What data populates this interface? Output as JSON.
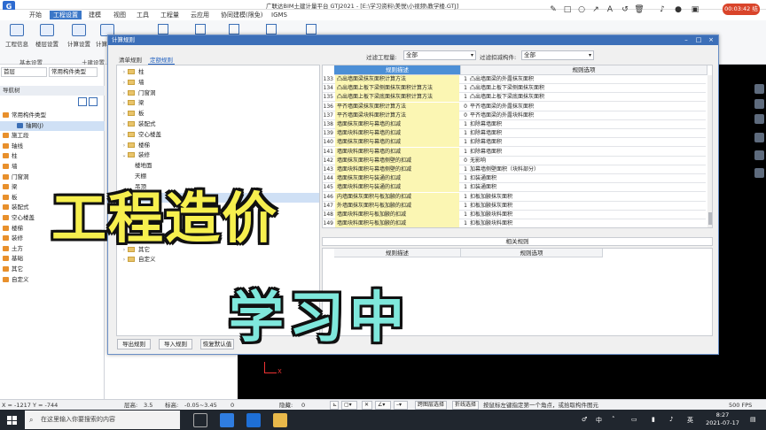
{
  "app": {
    "title": "广联达BIM土建计量平台 GTJ2021 - [E:\\学习资料\\美悦\\小视频\\教学楼.GTJ]",
    "timer": "00:03:42 结束"
  },
  "menu": [
    "开始",
    "工程设置",
    "建模",
    "视图",
    "工具",
    "工程量",
    "云应用",
    "协同建模(限免)",
    "IGMS"
  ],
  "menu_active": "工程设置",
  "ribbon": {
    "buttons": [
      "工程信息",
      "楼层设置",
      "计算设置",
      "计算规则"
    ],
    "groups": [
      "基本设置",
      "土建设置"
    ]
  },
  "left_panel": {
    "floor_combo": "首层",
    "type_combo": "常用构件类型",
    "axis_combo": "轴网",
    "nav_title": "导航树",
    "items": [
      "常用构件类型",
      "轴网(J)",
      "施工段",
      "轴线",
      "柱",
      "墙",
      "门窗洞",
      "梁",
      "板",
      "装配式",
      "空心楼盖",
      "楼梯",
      "装修",
      "土方",
      "基础",
      "其它",
      "自定义"
    ],
    "selected": "轴网(J)"
  },
  "dialog": {
    "title": "计算规则",
    "tabs": [
      "清单规则",
      "定额规则"
    ],
    "active_tab": "定额规则",
    "filter_project_label": "过滤工程量:",
    "filter_project_value": "全部",
    "filter_deduct_label": "过滤扣减构件:",
    "filter_deduct_value": "全部",
    "tree": [
      "柱",
      "墙",
      "门窗洞",
      "梁",
      "板",
      "装配式",
      "空心楼盖",
      "楼梯",
      "装修",
      "楼地面",
      "天棚",
      "吊顶",
      "墙面",
      "墙裙",
      "踢脚",
      "柱面",
      "",
      "其它",
      "自定义"
    ],
    "tree_selected": "墙面",
    "grid_headers": [
      "规则描述",
      "规则选项"
    ],
    "rows": [
      {
        "n": "133",
        "d": "凸出墙面梁抹灰面积计算方法",
        "v": "1",
        "o": "凸出墙面梁的外露抹灰面积"
      },
      {
        "n": "134",
        "d": "凸出墙面上板下梁侧面抹灰面积计算方法",
        "v": "1",
        "o": "凸出墙面上板下梁侧面抹灰面积"
      },
      {
        "n": "135",
        "d": "凸出墙面上板下梁底面抹灰面积计算方法",
        "v": "1",
        "o": "凸出墙面上板下梁底面抹灰面积"
      },
      {
        "n": "136",
        "d": "平齐墙面梁抹灰面积计算方法",
        "v": "0",
        "o": "平齐墙面梁的外露抹灰面积"
      },
      {
        "n": "137",
        "d": "平齐墙面梁块料面积计算方法",
        "v": "0",
        "o": "平齐墙面梁的外露块料面积"
      },
      {
        "n": "138",
        "d": "墙面抹灰面积与幕墙的扣减",
        "v": "1",
        "o": "扣除幕墙面积"
      },
      {
        "n": "139",
        "d": "墙面块料面积与幕墙的扣减",
        "v": "1",
        "o": "扣除幕墙面积"
      },
      {
        "n": "140",
        "d": "墙面抹灰面积与幕墙的扣减",
        "v": "1",
        "o": "扣除幕墙面积"
      },
      {
        "n": "141",
        "d": "墙面块料面积与幕墙的扣减",
        "v": "1",
        "o": "扣除幕墙面积"
      },
      {
        "n": "142",
        "d": "墙面抹灰面积与幕墙侧壁的扣减",
        "v": "0",
        "o": "无影响"
      },
      {
        "n": "143",
        "d": "墙面块料面积与幕墙侧壁的扣减",
        "v": "1",
        "o": "加幕墙侧壁面积（块料部分）"
      },
      {
        "n": "144",
        "d": "墙面抹灰面积与装通的扣减",
        "v": "1",
        "o": "扣装通面积"
      },
      {
        "n": "145",
        "d": "墙面块料面积与装通的扣减",
        "v": "1",
        "o": "扣装通面积"
      },
      {
        "n": "146",
        "d": "内墙面抹灰面积与板加腋的扣减",
        "v": "1",
        "o": "扣板加腋抹灰面积"
      },
      {
        "n": "147",
        "d": "外墙面抹灰面积与板加腋的扣减",
        "v": "1",
        "o": "扣板加腋抹灰面积"
      },
      {
        "n": "148",
        "d": "墙面块料面积与板加腋的扣减",
        "v": "1",
        "o": "扣板加腋块料面积"
      },
      {
        "n": "149",
        "d": "墙面块料面积与板加腋的扣减",
        "v": "1",
        "o": "扣板加腋块料面积"
      }
    ],
    "related_title": "相关规则",
    "related_headers": [
      "规则描述",
      "规则选项"
    ],
    "buttons": [
      "导出规则",
      "导入规则",
      "恢复默认值"
    ]
  },
  "overlay": {
    "line1": "工程造价",
    "line2": "学习中"
  },
  "status": {
    "coords": "X = -1217 Y = -744",
    "floor_height_label": "层高:",
    "floor_height": "3.5",
    "elevation_label": "标高:",
    "elevation": "-0.05~3.45",
    "zero": "0",
    "hidden_label": "隐藏:",
    "hidden": "0",
    "cross_layer": "跨图层选择",
    "polyline": "折线选择",
    "hint": "按鼠标左键指定第一个角点，或拾取构件图元",
    "fps": "500 FPS"
  },
  "taskbar": {
    "search_placeholder": "在这里输入你要搜索的内容",
    "ime": "中",
    "time": "8:27",
    "date": "2021-07-17"
  },
  "colors": {
    "accent": "#3c78c8",
    "yellow_cell": "#fbf6b3",
    "overlay1": "#f6ef4e",
    "overlay2": "#7fe8dc"
  }
}
